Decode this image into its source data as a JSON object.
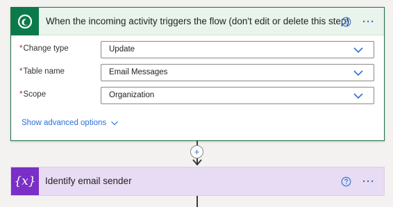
{
  "trigger_card": {
    "icon": "dataverse-icon",
    "title": "When the incoming activity triggers the flow (don't edit or delete this step)",
    "help_icon": "help-circle-icon",
    "more_label": "···",
    "fields": [
      {
        "required_mark": "*",
        "label": "Change type",
        "value": "Update"
      },
      {
        "required_mark": "*",
        "label": "Table name",
        "value": "Email Messages"
      },
      {
        "required_mark": "*",
        "label": "Scope",
        "value": "Organization"
      }
    ],
    "advanced_label": "Show advanced options",
    "accent_color": "#0b7a4b"
  },
  "connector": {
    "plus_label": "+"
  },
  "variable_card": {
    "icon": "variable-icon",
    "icon_text": "{x}",
    "title": "Identify email sender",
    "help_icon": "help-circle-icon",
    "more_label": "···",
    "accent_color": "#7a2fc6"
  }
}
